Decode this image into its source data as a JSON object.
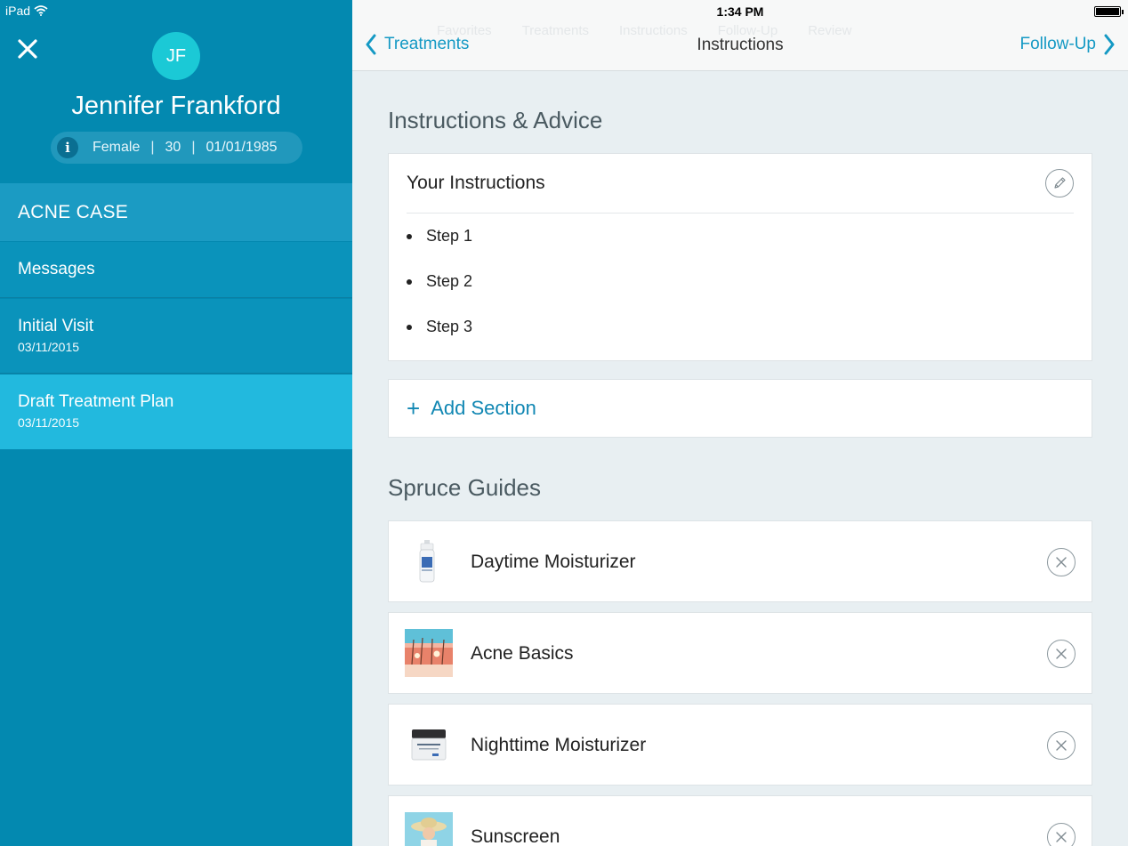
{
  "status_bar": {
    "device": "iPad",
    "time": "1:34 PM"
  },
  "sidebar": {
    "avatar_initials": "JF",
    "patient_name": "Jennifer Frankford",
    "gender": "Female",
    "age": "30",
    "dob": "01/01/1985",
    "sep": "|",
    "items": [
      {
        "label": "ACNE CASE"
      },
      {
        "label": "Messages"
      },
      {
        "label": "Initial Visit",
        "date": "03/11/2015"
      },
      {
        "label": "Draft Treatment Plan",
        "date": "03/11/2015"
      }
    ]
  },
  "navbar": {
    "back_label": "Treatments",
    "title": "Instructions",
    "forward_label": "Follow-Up",
    "ghost_tabs": [
      "Favorites",
      "Treatments",
      "Instructions",
      "Follow-Up",
      "Review"
    ]
  },
  "instructions": {
    "section_title": "Instructions & Advice",
    "card_title": "Your Instructions",
    "steps": [
      "Step 1",
      "Step 2",
      "Step 3"
    ],
    "add_plus": "+",
    "add_label": "Add Section"
  },
  "guides": {
    "section_title": "Spruce Guides",
    "items": [
      {
        "label": "Daytime Moisturizer"
      },
      {
        "label": "Acne Basics"
      },
      {
        "label": "Nighttime Moisturizer"
      },
      {
        "label": "Sunscreen"
      }
    ]
  },
  "colors": {
    "sidebar_bg": "#0389b0",
    "accent": "#1499c4",
    "selected": "#22b9de",
    "avatar": "#1bc9d6"
  }
}
